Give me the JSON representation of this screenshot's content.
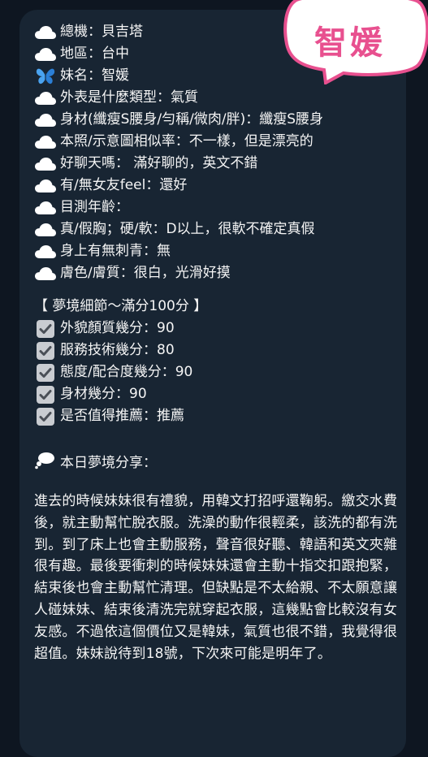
{
  "stamp": {
    "text": "智媛"
  },
  "profile": [
    {
      "icon": "cloud-icon",
      "text": "總機：貝吉塔"
    },
    {
      "icon": "cloud-icon",
      "text": "地區：台中"
    },
    {
      "icon": "butterfly-icon",
      "text": "妹名：智媛"
    },
    {
      "icon": "cloud-icon",
      "text": "外表是什麼類型：氣質"
    },
    {
      "icon": "cloud-icon",
      "text": "身材(纖瘦S腰身/勻稱/微肉/胖)：纖瘦S腰身"
    },
    {
      "icon": "cloud-icon",
      "text": "本照/示意圖相似率：不一樣，但是漂亮的"
    },
    {
      "icon": "cloud-icon",
      "text": "好聊天嗎： 滿好聊的，英文不錯"
    },
    {
      "icon": "cloud-icon",
      "text": "有/無女友feel：還好"
    },
    {
      "icon": "cloud-icon",
      "text": "目測年齡："
    },
    {
      "icon": "cloud-icon",
      "text": "真/假胸；硬/軟：D以上，很軟不確定真假"
    },
    {
      "icon": "cloud-icon",
      "text": "身上有無刺青：無"
    },
    {
      "icon": "cloud-icon",
      "text": "膚色/膚質：很白，光滑好摸"
    }
  ],
  "rating": {
    "header": "【 夢境細節～滿分100分 】",
    "items": [
      {
        "text": "外貌顏質幾分：90"
      },
      {
        "text": "服務技術幾分：80"
      },
      {
        "text": "態度/配合度幾分：90"
      },
      {
        "text": "身材幾分：90"
      },
      {
        "text": "是否值得推薦：推薦"
      }
    ]
  },
  "share": {
    "icon": "thought-bubble-icon",
    "title": "本日夢境分享：",
    "story": "進去的時候妹妹很有禮貌，用韓文打招呼還鞠躬。繳交水費後，就主動幫忙脫衣服。洗澡的動作很輕柔，該洗的都有洗到。到了床上也會主動服務，聲音很好聽、韓語和英文夾雜很有趣。最後要衝刺的時候妹妹還會主動十指交扣跟抱緊，結束後也會主動幫忙清理。但缺點是不太給親、不太願意讓人碰妹妹、結束後清洗完就穿起衣服，這幾點會比較沒有女友感。不過依這個價位又是韓妹，氣質也很不錯，我覺得很超值。妹妹說待到18號，下次來可能是明年了。"
  },
  "colors": {
    "background": "#0e1621",
    "bubble": "#182533",
    "text": "#f5f5f5",
    "stamp_accent": "#e8508f"
  }
}
